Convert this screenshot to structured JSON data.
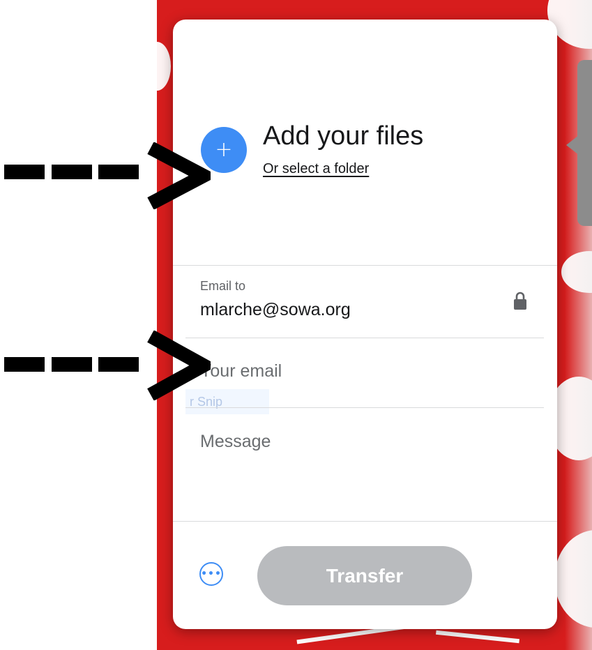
{
  "upload": {
    "title": "Add your files",
    "folder_link": "Or select a folder",
    "add_symbol": "+"
  },
  "form": {
    "email_to_label": "Email to",
    "email_to_value": "mlarche@sowa.org",
    "your_email_placeholder": "Your email",
    "message_placeholder": "Message"
  },
  "footer": {
    "more_symbol": "•••",
    "transfer_label": "Transfer"
  },
  "overlay": {
    "snip_text": "r Snip"
  },
  "colors": {
    "accent": "#3e8df5",
    "background_red": "#d71d1d",
    "transfer_disabled": "#b9bbbe",
    "annotation": "#000000"
  },
  "icons": [
    "plus-icon",
    "lock-icon",
    "more-icon",
    "arrow-annotation-icon"
  ]
}
